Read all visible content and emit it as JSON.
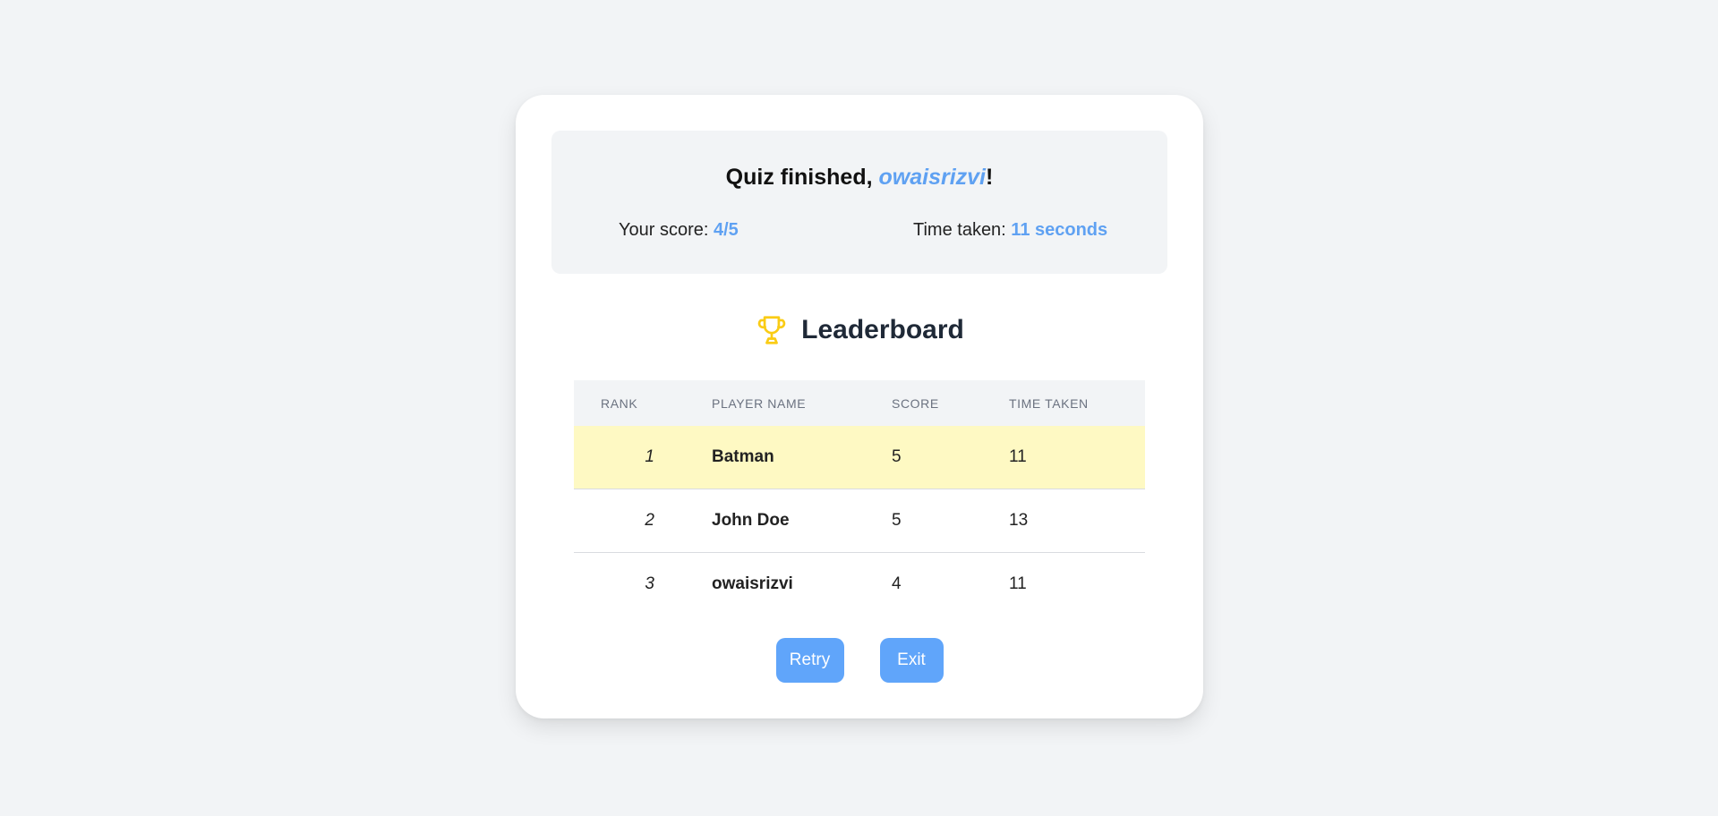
{
  "summary": {
    "title_prefix": "Quiz finished, ",
    "username": "owaisrizvi",
    "title_suffix": "!",
    "score_label": "Your score: ",
    "score_value": "4/5",
    "time_label": "Time taken: ",
    "time_value": "11 seconds"
  },
  "leaderboard": {
    "icon": "trophy-icon",
    "title": "Leaderboard",
    "columns": {
      "rank": "RANK",
      "name": "PLAYER NAME",
      "score": "SCORE",
      "time": "TIME TAKEN"
    },
    "rows": [
      {
        "rank": "1",
        "name": "Batman",
        "score": "5",
        "time": "11"
      },
      {
        "rank": "2",
        "name": "John Doe",
        "score": "5",
        "time": "13"
      },
      {
        "rank": "3",
        "name": "owaisrizvi",
        "score": "4",
        "time": "11"
      }
    ]
  },
  "buttons": {
    "retry": "Retry",
    "exit": "Exit"
  },
  "colors": {
    "accent": "#5fa1f2",
    "button": "#60a5fa",
    "highlight_row": "#fef9c3",
    "trophy": "#facc15",
    "background": "#f2f4f6"
  }
}
